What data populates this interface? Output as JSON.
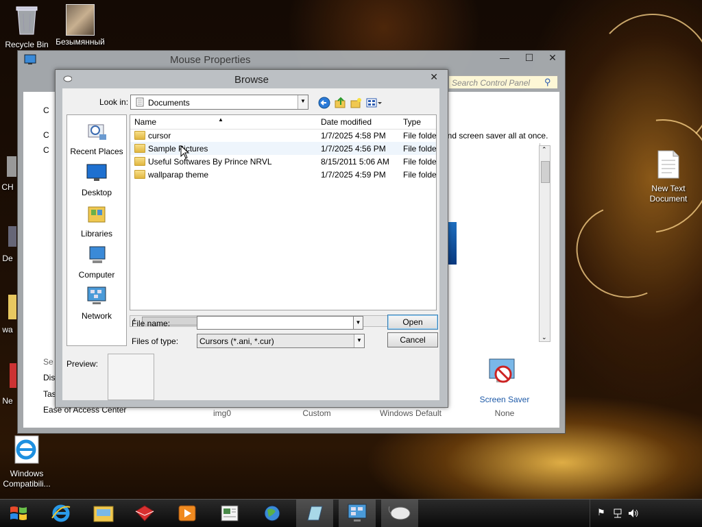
{
  "desktop": {
    "icons": [
      {
        "label": "Recycle Bin"
      },
      {
        "label": "Безымянный"
      },
      {
        "label": "New Text Document"
      },
      {
        "label": "Windows Compatibili..."
      }
    ],
    "fragments": [
      "CH",
      "De",
      "wa",
      "Ne"
    ]
  },
  "mouse_properties": {
    "title": "Mouse Properties",
    "search_placeholder": "Search Control Panel",
    "partial_text": "and screen saver all at once.",
    "left_fragments": [
      "C",
      "C",
      "C",
      "Se",
      "Disp",
      "Tas",
      "Ease of Access Center"
    ],
    "themes": [
      {
        "label": "img0"
      },
      {
        "label": "Custom"
      },
      {
        "label": "Windows Default"
      },
      {
        "label": "None"
      }
    ],
    "screen_saver_label": "Screen Saver"
  },
  "browse": {
    "title": "Browse",
    "look_in_label": "Look in:",
    "look_in_value": "Documents",
    "places": [
      {
        "label": "Recent Places"
      },
      {
        "label": "Desktop"
      },
      {
        "label": "Libraries"
      },
      {
        "label": "Computer"
      },
      {
        "label": "Network"
      }
    ],
    "columns": {
      "name": "Name",
      "date": "Date modified",
      "type": "Type"
    },
    "files": [
      {
        "name": "cursor",
        "date": "1/7/2025 4:58 PM",
        "type": "File folder"
      },
      {
        "name": "Sample Pictures",
        "date": "1/7/2025 4:56 PM",
        "type": "File folder"
      },
      {
        "name": "Useful Softwares By Prince NRVL",
        "date": "8/15/2011 5:06 AM",
        "type": "File folder"
      },
      {
        "name": "wallparap theme",
        "date": "1/7/2025 4:59 PM",
        "type": "File folder"
      }
    ],
    "file_name_label": "File name:",
    "file_name_value": "",
    "files_of_type_label": "Files of type:",
    "files_of_type_value": "Cursors (*.ani, *.cur)",
    "open_label": "Open",
    "cancel_label": "Cancel",
    "preview_label": "Preview:"
  }
}
